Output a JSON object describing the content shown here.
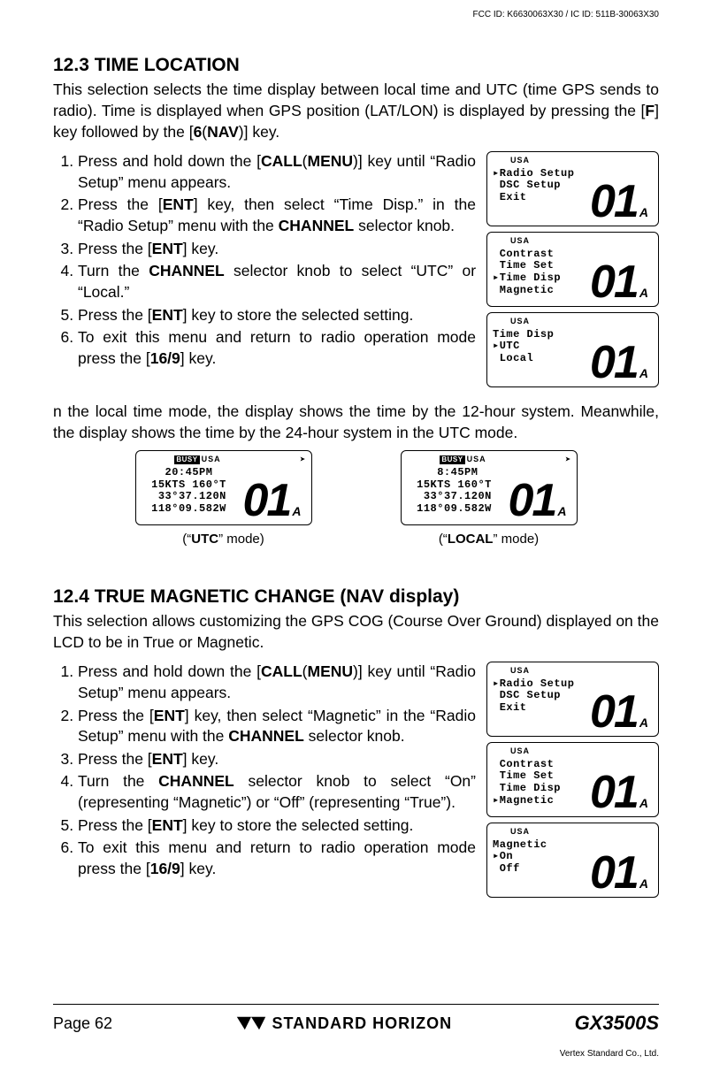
{
  "header": {
    "fcc": "FCC ID: K6630063X30 / IC ID: 511B-30063X30"
  },
  "s123": {
    "title": "12.3  TIME LOCATION",
    "intro_html": "This selection selects the time display between local time and UTC (time GPS sends to radio). Time is displayed when GPS position (LAT/LON) is displayed by pressing the [<b>F</b>] key followed by the [<b>6</b>(<b>NAV</b>)] key.",
    "steps_html": [
      "Press and hold down the [<b>CALL</b>(<b>MENU</b>)] key until “<span class='menu-label'>Radio Setup</span>” menu appears.",
      "Press the [<b>ENT</b>] key, then select “<span class='menu-label'>Time Disp.</span>” in the “<span class='menu-label'>Radio Setup</span>” menu with the <b>CHANNEL</b> selector knob.",
      "Press the [<b>ENT</b>] key.",
      "Turn the <b>CHANNEL</b> selector knob to select “<span class='menu-label'>UTC</span>” or “<span class='menu-label'>Local</span>.”",
      "Press the [<b>ENT</b>] key to store  the selected setting.",
      "To exit this menu and return to radio operation mode press the [<b>16/9</b>] key."
    ],
    "note_html": "n the local time mode, the display shows the time by the 12-hour system. Meanwhile, the display shows the time by the 24-hour system in the UTC mode.",
    "lcd": [
      {
        "usa": "USA",
        "lines": [
          "▸Radio Setup",
          " DSC Setup",
          " Exit"
        ],
        "ch": "01",
        "suf": "A"
      },
      {
        "usa": "USA",
        "lines": [
          " Contrast",
          " Time Set",
          "▸Time Disp",
          " Magnetic"
        ],
        "ch": "01",
        "suf": "A"
      },
      {
        "usa": "USA",
        "lines": [
          "Time Disp",
          "▸UTC",
          " Local"
        ],
        "ch": "01",
        "suf": "A"
      }
    ],
    "examples": [
      {
        "usa": "USA",
        "busy": "BUSY",
        "lines": [
          "20:45PM",
          "15KTS 160°T",
          " 33°37.120N",
          "118°09.582W"
        ],
        "ch": "01",
        "suf": "A",
        "caption_html": "(“<b>UTC</b>” mode)"
      },
      {
        "usa": "USA",
        "busy": "BUSY",
        "lines": [
          " 8:45PM",
          "15KTS 160°T",
          " 33°37.120N",
          "118°09.582W"
        ],
        "ch": "01",
        "suf": "A",
        "caption_html": "(“<b>LOCAL</b>” mode)"
      }
    ]
  },
  "s124": {
    "title": "12.4  TRUE MAGNETIC CHANGE (NAV display)",
    "intro_html": "This selection allows customizing the GPS COG (Course Over Ground) displayed on the LCD to be in True or Magnetic.",
    "steps_html": [
      "Press and hold down the [<b>CALL</b>(<b>MENU</b>)] key until “<span class='menu-label'>Radio Setup</span>” menu appears.",
      "Press the [<b>ENT</b>] key, then select “<span class='menu-label'>Magnetic</span>” in the “<span class='menu-label'>Radio Setup</span>” menu with the <b>CHANNEL</b> selector knob.",
      "Press the [<b>ENT</b>] key.",
      "Turn the <b>CHANNEL</b> selector knob to select “<span class='menu-label'>On</span>” (representing “Magnetic”) or “<span class='menu-label'>Off</span>” (representing “True”).",
      "Press the [<b>ENT</b>] key to store the selected setting.",
      "To exit this menu and return to radio operation mode press the [<b>16/9</b>] key."
    ],
    "lcd": [
      {
        "usa": "USA",
        "lines": [
          "▸Radio Setup",
          " DSC Setup",
          " Exit"
        ],
        "ch": "01",
        "suf": "A"
      },
      {
        "usa": "USA",
        "lines": [
          " Contrast",
          " Time Set",
          " Time Disp",
          "▸Magnetic"
        ],
        "ch": "01",
        "suf": "A"
      },
      {
        "usa": "USA",
        "lines": [
          "Magnetic",
          "▸On",
          " Off"
        ],
        "ch": "01",
        "suf": "A"
      }
    ]
  },
  "footer": {
    "page": "Page 62",
    "brand": "STANDARD HORIZON",
    "model": "GX3500S",
    "vertex": "Vertex Standard Co., Ltd."
  }
}
